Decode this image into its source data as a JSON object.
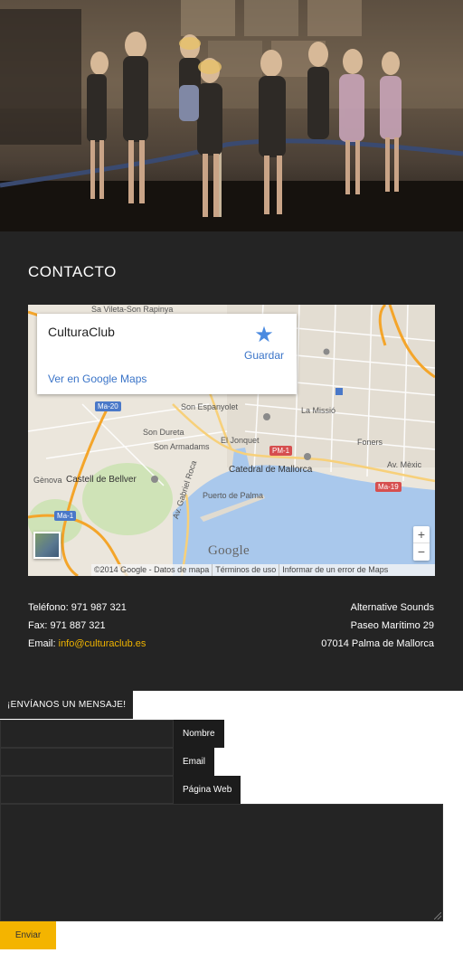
{
  "contact": {
    "title": "CONTACTO"
  },
  "map": {
    "card": {
      "name": "CulturaClub",
      "save_label": "Guardar",
      "view_link": "Ver en Google Maps"
    },
    "labels": [
      "Sa Vileta-Son Rapinya",
      "Ma-20",
      "Son Espanyolet",
      "La Missió",
      "Son Dureta",
      "El Jonquet",
      "PM-1",
      "Foners",
      "Son Armadams",
      "Gènova",
      "Castell de Bellver",
      "Catedral de Mallorca",
      "Av. Mèxic",
      "Puerto de Palma",
      "Ma-19",
      "Ma-1",
      "Av. Gabriel Roca"
    ],
    "logo": "Google",
    "zoom_in": "+",
    "zoom_out": "−",
    "attribution": {
      "copyright": "©2014 Google - Datos de mapa",
      "terms": "Términos de uso",
      "report": "Informar de un error de Maps"
    }
  },
  "info": {
    "phone_label": "Teléfono: 971 987 321",
    "fax_label": "Fax: 971 887 321",
    "email_prefix": "Email: ",
    "email": "info@culturaclub.es",
    "company": "Alternative Sounds",
    "street": "Paseo Marítimo 29",
    "city": "07014 Palma de Mallorca"
  },
  "form": {
    "heading": "¡ENVÍANOS UN MENSAJE!",
    "name_label": "Nombre",
    "email_label": "Email",
    "web_label": "Página Web",
    "submit": "Enviar"
  },
  "colors": {
    "dark_bg": "#242424",
    "accent": "#f4b400",
    "link": "#3a74c8"
  }
}
